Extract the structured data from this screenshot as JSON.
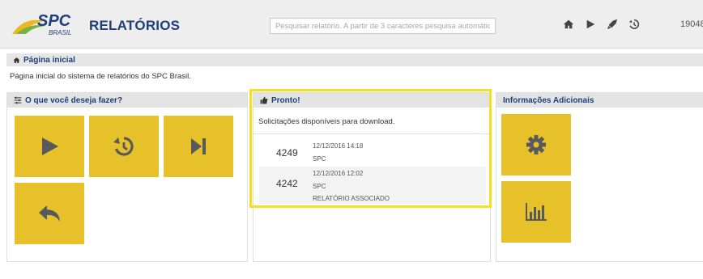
{
  "header": {
    "logo_text": "SPC",
    "logo_subtext": "BRASIL",
    "app_title": "RELATÓRIOS",
    "search_placeholder": "Pesquisar relatório. A partir de 3 caracteres pesquisa automática.",
    "nav_icons": [
      "home-icon",
      "play-icon",
      "rocket-icon",
      "history-icon"
    ],
    "user_code": "19048"
  },
  "breadcrumb": {
    "label": "Página inicial",
    "description": "Página inicial do sistema de relatórios do SPC Brasil."
  },
  "panels": {
    "actions": {
      "title": "O que você deseja fazer?",
      "tiles": [
        "play-icon",
        "history-icon",
        "step-forward-icon",
        "reply-icon"
      ]
    },
    "ready": {
      "title": "Pronto!",
      "notice": "Solicitações disponíveis para download.",
      "requests": [
        {
          "id": "4249",
          "datetime": "12/12/2016 14:18",
          "origin": "SPC",
          "extra": ""
        },
        {
          "id": "4242",
          "datetime": "12/12/2016 12:02",
          "origin": "SPC",
          "extra": "RELATÓRIO ASSOCIADO"
        }
      ]
    },
    "info": {
      "title": "Informações Adicionais",
      "tiles": [
        "gear-icon",
        "bar-chart-icon"
      ]
    }
  },
  "colors": {
    "brand_blue": "#1d3f7c",
    "tile_yellow": "#e7c12a",
    "highlight_yellow": "#f2e023",
    "header_bg": "#eeeeee"
  }
}
